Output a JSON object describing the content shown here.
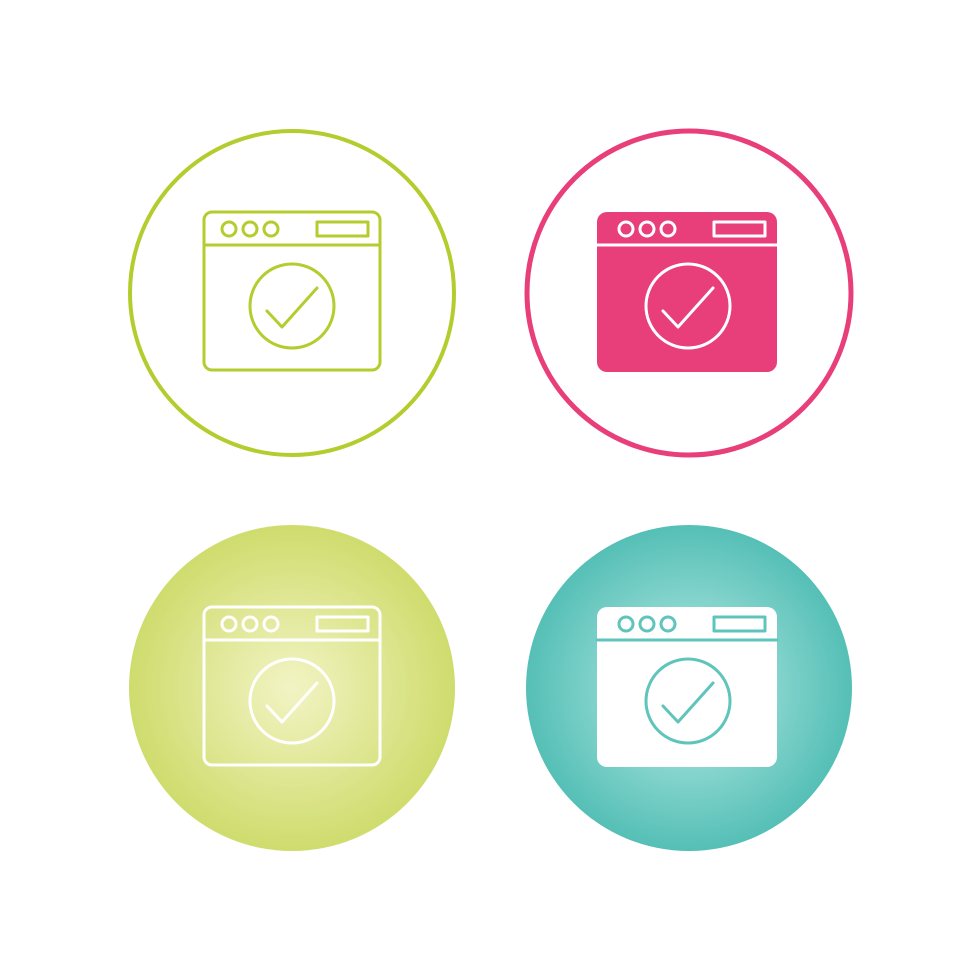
{
  "icon_set": {
    "icon": "browser-window-check-icon",
    "variants": [
      {
        "style": "outline",
        "background": "none",
        "ring": "#b5cc2e",
        "stroke": "#b5cc2e"
      },
      {
        "style": "filled",
        "background": "none",
        "ring": "#e83e7a",
        "fill": "#e83e7a",
        "stroke": "#ffffff"
      },
      {
        "style": "outline-on-circle",
        "background_center": "#f2f4c4",
        "background_edge": "#cfdc6d",
        "stroke": "#ffffff"
      },
      {
        "style": "filled-on-circle",
        "background_center": "#b9ece6",
        "background_edge": "#55bfb6",
        "fill": "#ffffff",
        "stroke": "#5fc4bb"
      }
    ]
  }
}
